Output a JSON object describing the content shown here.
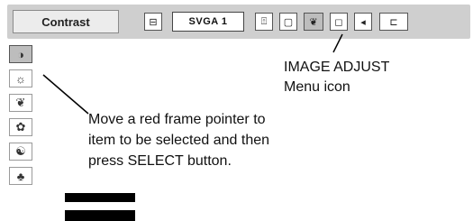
{
  "menu_bar": {
    "title": "Contrast",
    "input_label": "SVGA 1",
    "icons": [
      {
        "name": "input-icon",
        "glyph": "⊟"
      },
      {
        "name": "pc-adjust-icon",
        "glyph": "⍐"
      },
      {
        "name": "image-select-icon",
        "glyph": "▢"
      },
      {
        "name": "image-adjust-icon",
        "glyph": "❦"
      },
      {
        "name": "screen-icon",
        "glyph": "◻"
      },
      {
        "name": "sound-icon",
        "glyph": "◂"
      },
      {
        "name": "setting-icon",
        "glyph": "⊏"
      }
    ]
  },
  "side_menu": {
    "icons": [
      {
        "name": "contrast-icon",
        "glyph": "◑"
      },
      {
        "name": "brightness-icon",
        "glyph": "☼"
      },
      {
        "name": "color-icon",
        "glyph": "❦"
      },
      {
        "name": "tint-icon",
        "glyph": "✿"
      },
      {
        "name": "white-balance-icon",
        "glyph": "☯"
      },
      {
        "name": "sharpness-icon",
        "glyph": "♣"
      }
    ]
  },
  "callouts": {
    "image_adjust_line1": "IMAGE ADJUST",
    "image_adjust_line2": "Menu icon",
    "pointer_line1": "Move a red frame pointer to",
    "pointer_line2": "item to be selected and then",
    "pointer_line3": "press SELECT button."
  }
}
